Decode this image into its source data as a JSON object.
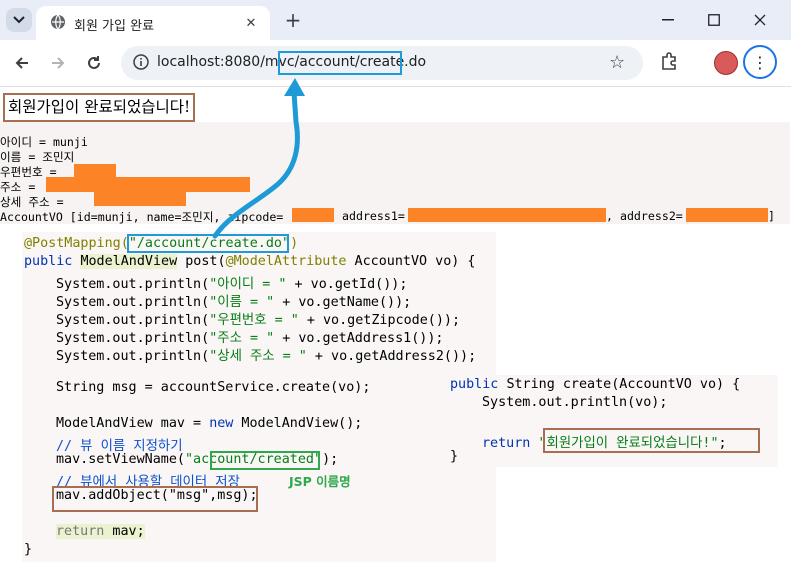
{
  "browser": {
    "tab_title": "회원 가입 완료",
    "url_host": "localhost:8080/mvc",
    "url_path": "/account/create.do"
  },
  "page": {
    "heading": "회원가입이 완료되었습니다!",
    "console_lines": [
      "아이디 = munji",
      "이름 = 조민지",
      "우편번호 = ",
      "주소 = ",
      "상세 주소 = ",
      "AccountVO [id=munji, name=조민지, zipcode=",
      "address1=",
      ", address2=",
      "]"
    ]
  },
  "code": {
    "mapping": "@PostMapping(",
    "mapping_path": "\"/account/create.do\"",
    "mapping_close": ")",
    "l2a": "public ",
    "l2b": "ModelAndView",
    "l2c": " post(",
    "l2d": "@ModelAttribute",
    "l2e": " AccountVO vo) {",
    "print_prefix": "System.out.println(",
    "p1": "\"아이디 = \"",
    "p1e": " + vo.getId());",
    "p2": "\"이름 = \"",
    "p2e": " + vo.getName());",
    "p3": "\"우편번호 = \"",
    "p3e": " + vo.getZipcode());",
    "p4": "\"주소 = \"",
    "p4e": " + vo.getAddress1());",
    "p5": "\"상세 주소 = \"",
    "p5e": " + vo.getAddress2());",
    "msg_line": "String msg = accountService.create(vo);",
    "mav_line_a": "ModelAndView mav = ",
    "mav_line_b": "new",
    "mav_line_c": " ModelAndView();",
    "comment1": "// 뷰 이름 지정하기",
    "setview_a": "mav.setViewName(",
    "setview_b": "\"account/created\"",
    "setview_c": ");",
    "comment2": "// 뷰에서 사용할 데이터 저장",
    "addobj": "mav.addObject(\"msg\",msg);",
    "ret_kw": "return",
    "ret_rest": " mav;",
    "close_brace": "}",
    "svc_a": "public ",
    "svc_b": "String create(AccountVO vo) {",
    "svc_print": "System.out.println(vo);",
    "svc_ret": "return ",
    "svc_ret_str": "\"회원가입이 완료되었습니다!\"",
    "svc_ret_end": ";",
    "svc_close": "}",
    "jsp_label": "JSP 이름명"
  },
  "colors": {
    "highlight_blue": "#1e9ad6",
    "highlight_green": "#2da84a",
    "highlight_brown": "#a86e52",
    "redaction": "#fd8327"
  },
  "icons": [
    "tab-search-icon",
    "globe-icon",
    "close-icon",
    "plus-icon",
    "minimize-icon",
    "maximize-icon",
    "back-icon",
    "forward-icon",
    "reload-icon",
    "site-info-icon",
    "star-icon",
    "extensions-icon",
    "profile-avatar-icon",
    "more-menu-icon",
    "arrow-icon"
  ]
}
